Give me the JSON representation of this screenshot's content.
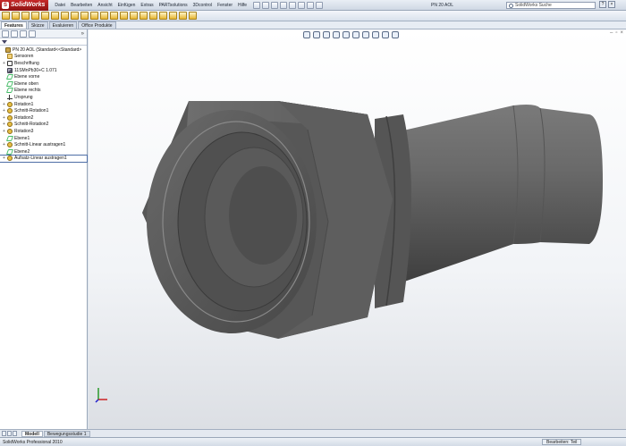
{
  "app": {
    "name": "SolidWorks",
    "document_title": "PN 20 AOL"
  },
  "menu": [
    "Datei",
    "Bearbeiten",
    "Ansicht",
    "Einfügen",
    "Extras",
    "PARTsolutions",
    "3Dcontrol",
    "Fenster",
    "Hilfe"
  ],
  "search": {
    "placeholder": "SolidWorks Suche"
  },
  "tabs": [
    "Features",
    "Skizze",
    "Evaluieren",
    "Office Produkte"
  ],
  "feature_tree": [
    {
      "label": "PN 20 AOL  (Standard<<Standard>",
      "icon": "part-icon",
      "expander": ""
    },
    {
      "label": "Sensoren",
      "icon": "folder-icon",
      "expander": ""
    },
    {
      "label": "Beschriftung",
      "icon": "annotation-icon",
      "expander": "+"
    },
    {
      "label": "11SMnPb30+C 1.071",
      "icon": "material-icon",
      "expander": ""
    },
    {
      "label": "Ebene vorne",
      "icon": "plane-icon",
      "expander": ""
    },
    {
      "label": "Ebene oben",
      "icon": "plane-icon",
      "expander": ""
    },
    {
      "label": "Ebene rechts",
      "icon": "plane-icon",
      "expander": ""
    },
    {
      "label": "Ursprung",
      "icon": "origin-icon",
      "expander": ""
    },
    {
      "label": "Rotation1",
      "icon": "feature-icon",
      "expander": "+"
    },
    {
      "label": "Schnitt-Rotation1",
      "icon": "feature-icon",
      "expander": "+"
    },
    {
      "label": "Rotation2",
      "icon": "feature-icon",
      "expander": "+"
    },
    {
      "label": "Schnitt-Rotation2",
      "icon": "feature-icon",
      "expander": "+"
    },
    {
      "label": "Rotation3",
      "icon": "feature-icon",
      "expander": "+"
    },
    {
      "label": "Ebene1",
      "icon": "plane-icon",
      "expander": ""
    },
    {
      "label": "Schnitt-Linear austragen1",
      "icon": "feature-icon",
      "expander": "+"
    },
    {
      "label": "Ebene2",
      "icon": "plane-icon",
      "expander": ""
    },
    {
      "label": "Aufsatz-Linear austragen1",
      "icon": "feature-icon",
      "expander": "+"
    }
  ],
  "bottom_tabs": [
    "Modell",
    "Bewegungsstudie 1"
  ],
  "status": {
    "left": "SolidWorks Professional 2010",
    "right": "Bearbeiten: Teil"
  }
}
